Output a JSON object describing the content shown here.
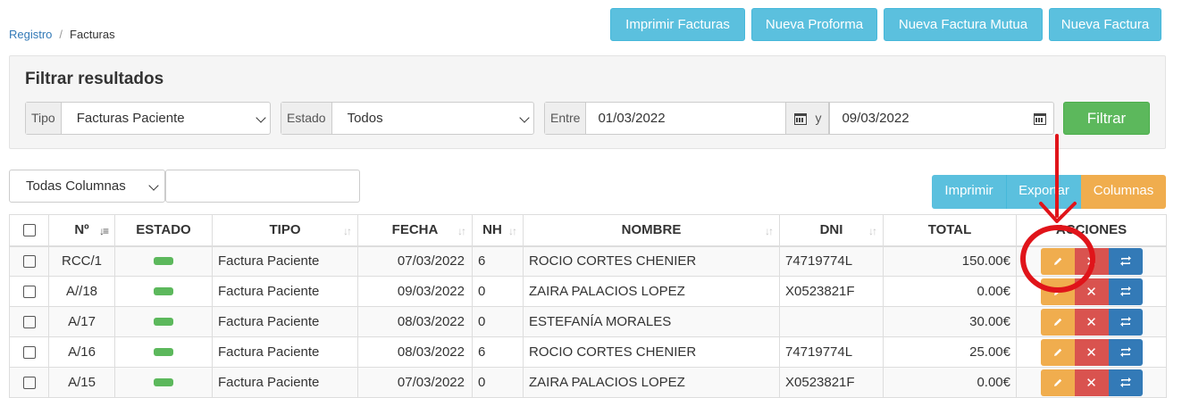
{
  "breadcrumb": {
    "parent": "Registro",
    "current": "Facturas",
    "separator": "/"
  },
  "top_buttons": [
    {
      "label": "Imprimir Facturas"
    },
    {
      "label": "Nueva Proforma"
    },
    {
      "label": "Nueva Factura Mutua"
    },
    {
      "label": "Nueva Factura"
    }
  ],
  "filter": {
    "title": "Filtrar resultados",
    "tipo_label": "Tipo",
    "tipo_value": "Facturas Paciente",
    "estado_label": "Estado",
    "estado_value": "Todos",
    "entre_label": "Entre",
    "date_from": "01/03/2022",
    "y_label": "y",
    "date_to": "09/03/2022",
    "submit_label": "Filtrar"
  },
  "table_tools": {
    "columns_select": "Todas Columnas",
    "search_value": "",
    "imprimir": "Imprimir",
    "exportar": "Exportar",
    "columnas": "Columnas"
  },
  "table": {
    "headers": [
      "Nº",
      "ESTADO",
      "TIPO",
      "FECHA",
      "NH",
      "NOMBRE",
      "DNI",
      "TOTAL",
      "ACCIONES"
    ],
    "rows": [
      {
        "num": "RCC/1",
        "tipo": "Factura Paciente",
        "fecha": "07/03/2022",
        "nh": "6",
        "nombre": "ROCIO CORTES CHENIER",
        "dni": "74719774L",
        "total": "150.00€"
      },
      {
        "num": "A//18",
        "tipo": "Factura Paciente",
        "fecha": "09/03/2022",
        "nh": "0",
        "nombre": "ZAIRA PALACIOS LOPEZ",
        "dni": "X0523821F",
        "total": "0.00€"
      },
      {
        "num": "A/17",
        "tipo": "Factura Paciente",
        "fecha": "08/03/2022",
        "nh": "0",
        "nombre": "ESTEFANÍA MORALES",
        "dni": "",
        "total": "30.00€"
      },
      {
        "num": "A/16",
        "tipo": "Factura Paciente",
        "fecha": "08/03/2022",
        "nh": "6",
        "nombre": "ROCIO CORTES CHENIER",
        "dni": "74719774L",
        "total": "25.00€"
      },
      {
        "num": "A/15",
        "tipo": "Factura Paciente",
        "fecha": "07/03/2022",
        "nh": "0",
        "nombre": "ZAIRA PALACIOS LOPEZ",
        "dni": "X0523821F",
        "total": "0.00€"
      }
    ]
  },
  "colors": {
    "info": "#5bc0de",
    "success": "#5cb85c",
    "warning": "#f0ad4e",
    "danger": "#d9534f",
    "primary": "#337ab7",
    "annotation": "#e0141a"
  },
  "icons": {
    "edit": "pencil-icon",
    "delete": "close-icon",
    "transfer": "arrows-swap-icon",
    "calendar": "calendar-icon"
  }
}
